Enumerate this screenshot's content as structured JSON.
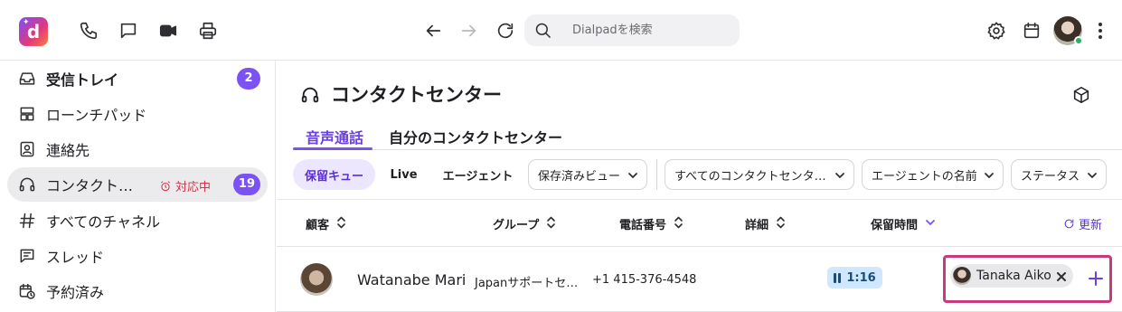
{
  "topbar": {
    "logo_letter": "d",
    "search_placeholder": "Dialpadを検索",
    "icons": [
      "phone-icon",
      "message-icon",
      "video-icon",
      "print-icon",
      "back-icon",
      "forward-icon",
      "reload-icon",
      "search-icon",
      "gear-icon",
      "calendar-icon",
      "more-icon"
    ]
  },
  "sidebar": {
    "items": [
      {
        "label": "受信トレイ",
        "badge": "2",
        "icon": "inbox-icon"
      },
      {
        "label": "ローンチパッド",
        "icon": "launchpad-icon"
      },
      {
        "label": "連絡先",
        "icon": "contacts-icon"
      },
      {
        "label": "コンタクト…",
        "status": "対応中",
        "badge": "19",
        "icon": "headset-icon"
      },
      {
        "label": "すべてのチャネル",
        "icon": "hash-icon"
      },
      {
        "label": "スレッド",
        "icon": "threads-icon"
      },
      {
        "label": "予約済み",
        "icon": "scheduled-icon"
      }
    ]
  },
  "main": {
    "title": "コンタクトセンター",
    "tabs": [
      {
        "label": "音声通話"
      },
      {
        "label": "自分のコンタクトセンター"
      }
    ],
    "filters": {
      "queue": "保留キュー",
      "live": "Live",
      "agent": "エージェント",
      "saved_views": "保存済みビュー",
      "all_centers": "すべてのコンタクトセンタ…",
      "agent_name": "エージェントの名前",
      "status": "ステータス"
    },
    "table": {
      "headers": {
        "customer": "顧客",
        "group": "グループ",
        "phone": "電話番号",
        "details": "詳細",
        "hold_time": "保留時間",
        "refresh": "更新"
      },
      "rows": [
        {
          "name": "Watanabe Mari",
          "group": "Japanサポートセ…",
          "phone": "+1 415-376-4548",
          "hold_time": "1:16",
          "agent": "Tanaka Aiko"
        }
      ]
    }
  },
  "colors": {
    "accent": "#7c52f5",
    "oncall": "#d2334a",
    "hold_badge_bg": "#cfe8ff",
    "agent_highlight": "#c83a7d"
  }
}
